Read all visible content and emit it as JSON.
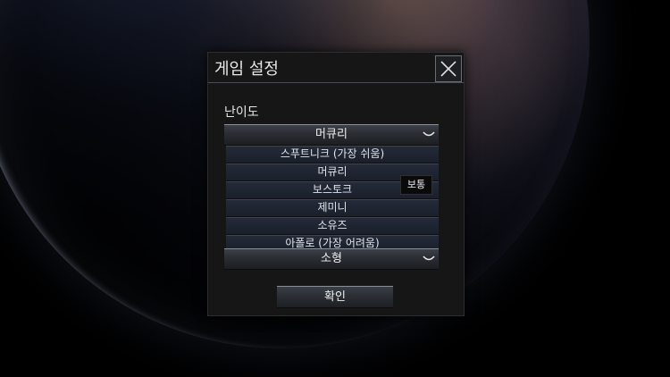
{
  "dialog": {
    "title": "게임 설정",
    "close_icon": "close-icon",
    "difficulty_label": "난이도",
    "difficulty_selected": "머큐리",
    "difficulty_options": [
      "스푸트니크 (가장 쉬움)",
      "머큐리",
      "보스토크",
      "제미니",
      "소유즈",
      "아폴로 (가장 어려움)"
    ],
    "tooltip": "보통",
    "size_selected": "소형",
    "ok_label": "확인"
  },
  "colors": {
    "dialog_bg": "#161616",
    "list_item_bg": "#1f2431",
    "text": "#e6e6e6"
  }
}
